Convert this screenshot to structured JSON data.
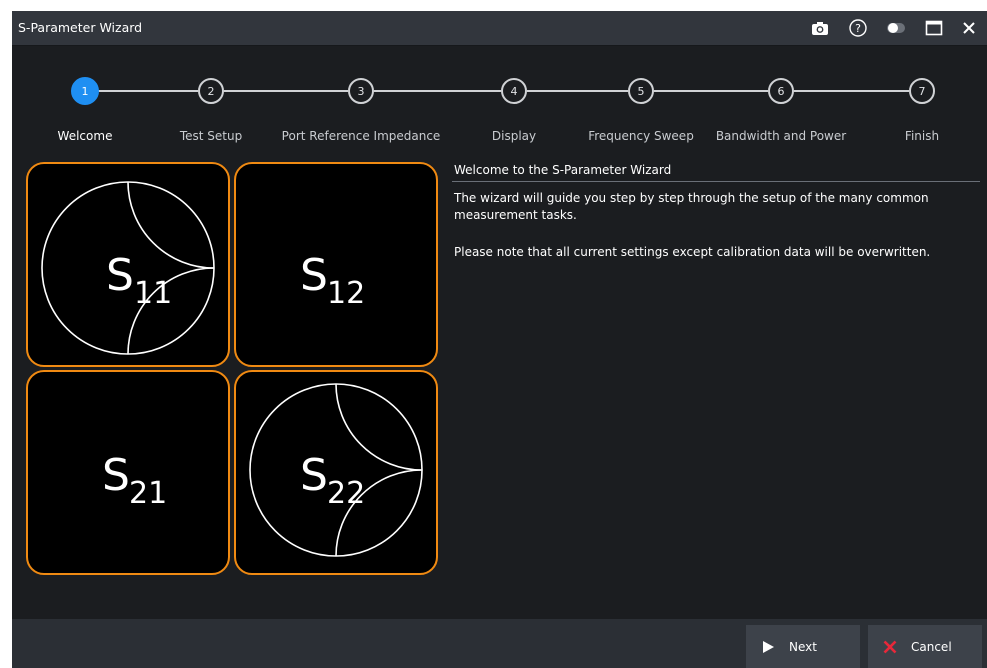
{
  "window": {
    "title": "S-Parameter Wizard"
  },
  "titlebar_icons": [
    "camera-icon",
    "help-icon",
    "toggle-icon",
    "maximize-icon",
    "close-icon"
  ],
  "steps": [
    {
      "number": "1",
      "label": "Welcome",
      "active": true
    },
    {
      "number": "2",
      "label": "Test Setup",
      "active": false
    },
    {
      "number": "3",
      "label": "Port Reference Impedance",
      "active": false
    },
    {
      "number": "4",
      "label": "Display",
      "active": false
    },
    {
      "number": "5",
      "label": "Frequency Sweep",
      "active": false
    },
    {
      "number": "6",
      "label": "Bandwidth and Power",
      "active": false
    },
    {
      "number": "7",
      "label": "Finish",
      "active": false
    }
  ],
  "tiles": [
    {
      "letter": "S",
      "subscript": "11",
      "smith_chart": true
    },
    {
      "letter": "S",
      "subscript": "12",
      "smith_chart": false
    },
    {
      "letter": "S",
      "subscript": "21",
      "smith_chart": false
    },
    {
      "letter": "S",
      "subscript": "22",
      "smith_chart": true
    }
  ],
  "info": {
    "title": "Welcome to the S-Parameter Wizard",
    "paragraph1": "The wizard will guide you step by step through the setup of the many common measurement tasks.",
    "paragraph2": "Please note that all current settings except calibration data will be overwritten."
  },
  "footer": {
    "next_label": "Next",
    "cancel_label": "Cancel"
  },
  "colors": {
    "accent": "#1f8ff2",
    "tile_border": "#f08a12",
    "cancel_icon": "#e8283a"
  }
}
